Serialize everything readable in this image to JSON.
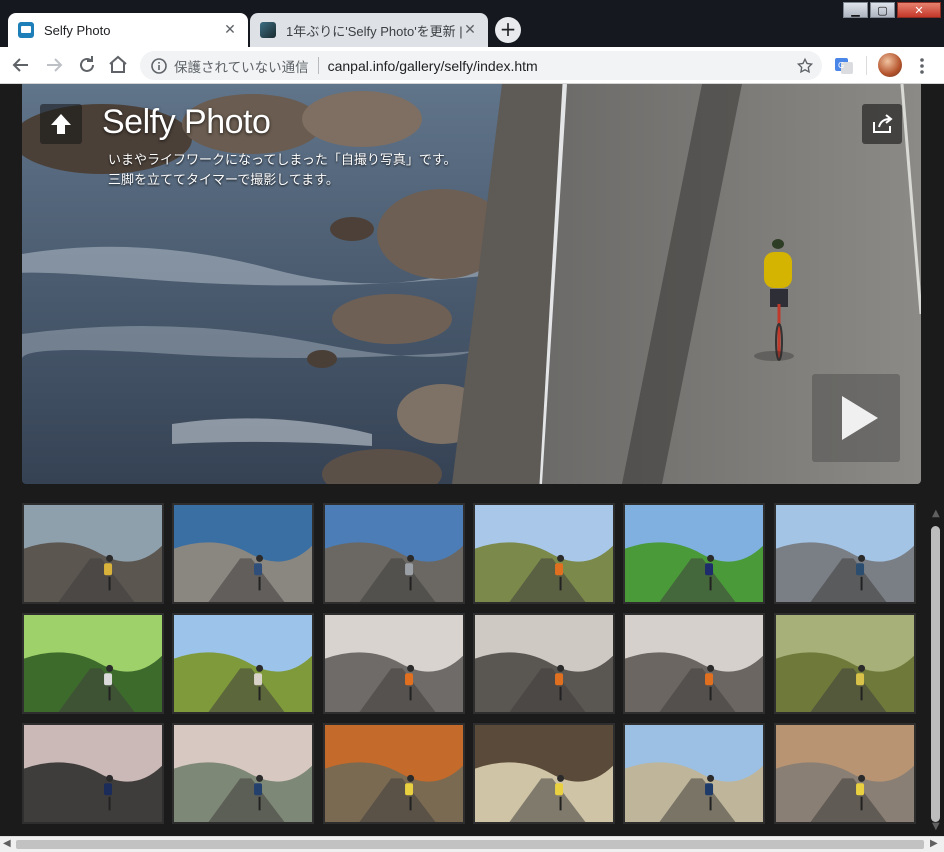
{
  "browser": {
    "tabs": [
      {
        "title": "Selfy Photo",
        "active": true
      },
      {
        "title": "1年ぶりに'Selfy Photo'を更新 |",
        "active": false
      }
    ],
    "address": {
      "security_text": "保護されていない通信",
      "url": "canpal.info/gallery/selfy/index.htm"
    },
    "window_controls": [
      "minimize",
      "maximize",
      "close"
    ]
  },
  "hero": {
    "title": "Selfy Photo",
    "description_line1": "いまやライフワークになってしまった「自撮り写真」です。",
    "description_line2": "三脚を立ててタイマーで撮影してます。",
    "icons": [
      "up-arrow-icon",
      "share-icon",
      "play-icon"
    ]
  },
  "thumbnails": [
    {
      "scene": "coastal-road",
      "sky": "#8fa0ad",
      "ground": "#5b5650",
      "accent": "#d8b23a"
    },
    {
      "scene": "breakwater",
      "sky": "#3a6fa3",
      "ground": "#8a8680",
      "accent": "#2f4f7a"
    },
    {
      "scene": "rocky-shore",
      "sky": "#4c7db6",
      "ground": "#6b6863",
      "accent": "#9aa0a6"
    },
    {
      "scene": "mountain-road",
      "sky": "#a9c7e8",
      "ground": "#7b8a4a",
      "accent": "#e07020"
    },
    {
      "scene": "seaside-fence",
      "sky": "#7fb0e0",
      "ground": "#4b9a3a",
      "accent": "#1f2c6b"
    },
    {
      "scene": "harbor-island",
      "sky": "#a4c4e6",
      "ground": "#7a7f86",
      "accent": "#2b4d6f"
    },
    {
      "scene": "forest-tunnel",
      "sky": "#9fd16b",
      "ground": "#3d6b2c",
      "accent": "#dadada"
    },
    {
      "scene": "mountain-field",
      "sky": "#9cc3ea",
      "ground": "#7f9a3b",
      "accent": "#d9d2c8"
    },
    {
      "scene": "cherry-blossom",
      "sky": "#d8d3cf",
      "ground": "#6f6b68",
      "accent": "#e07020"
    },
    {
      "scene": "cherry-blossom",
      "sky": "#cfc9c4",
      "ground": "#5a5652",
      "accent": "#e07020"
    },
    {
      "scene": "cherry-blossom",
      "sky": "#d6d0cc",
      "ground": "#6c6662",
      "accent": "#e07020"
    },
    {
      "scene": "autumn-hill",
      "sky": "#a8b07a",
      "ground": "#6f7a3a",
      "accent": "#d8c24a"
    },
    {
      "scene": "blossom-tunnel",
      "sky": "#cbb9b7",
      "ground": "#3f3d3b",
      "accent": "#1b2b5a"
    },
    {
      "scene": "blossom-slope",
      "sky": "#d8c8c2",
      "ground": "#7e8876",
      "accent": "#24406d"
    },
    {
      "scene": "autumn-forest",
      "sky": "#c46a2a",
      "ground": "#7a6a52",
      "accent": "#e8d040"
    },
    {
      "scene": "pampas-grass",
      "sky": "#5a4a3a",
      "ground": "#cfc4a6",
      "accent": "#e8d040"
    },
    {
      "scene": "pampas-hill",
      "sky": "#9bc0e4",
      "ground": "#bfb59a",
      "accent": "#1f3b6a"
    },
    {
      "scene": "autumn-road",
      "sky": "#b89472",
      "ground": "#8a7f74",
      "accent": "#e8d040"
    }
  ]
}
